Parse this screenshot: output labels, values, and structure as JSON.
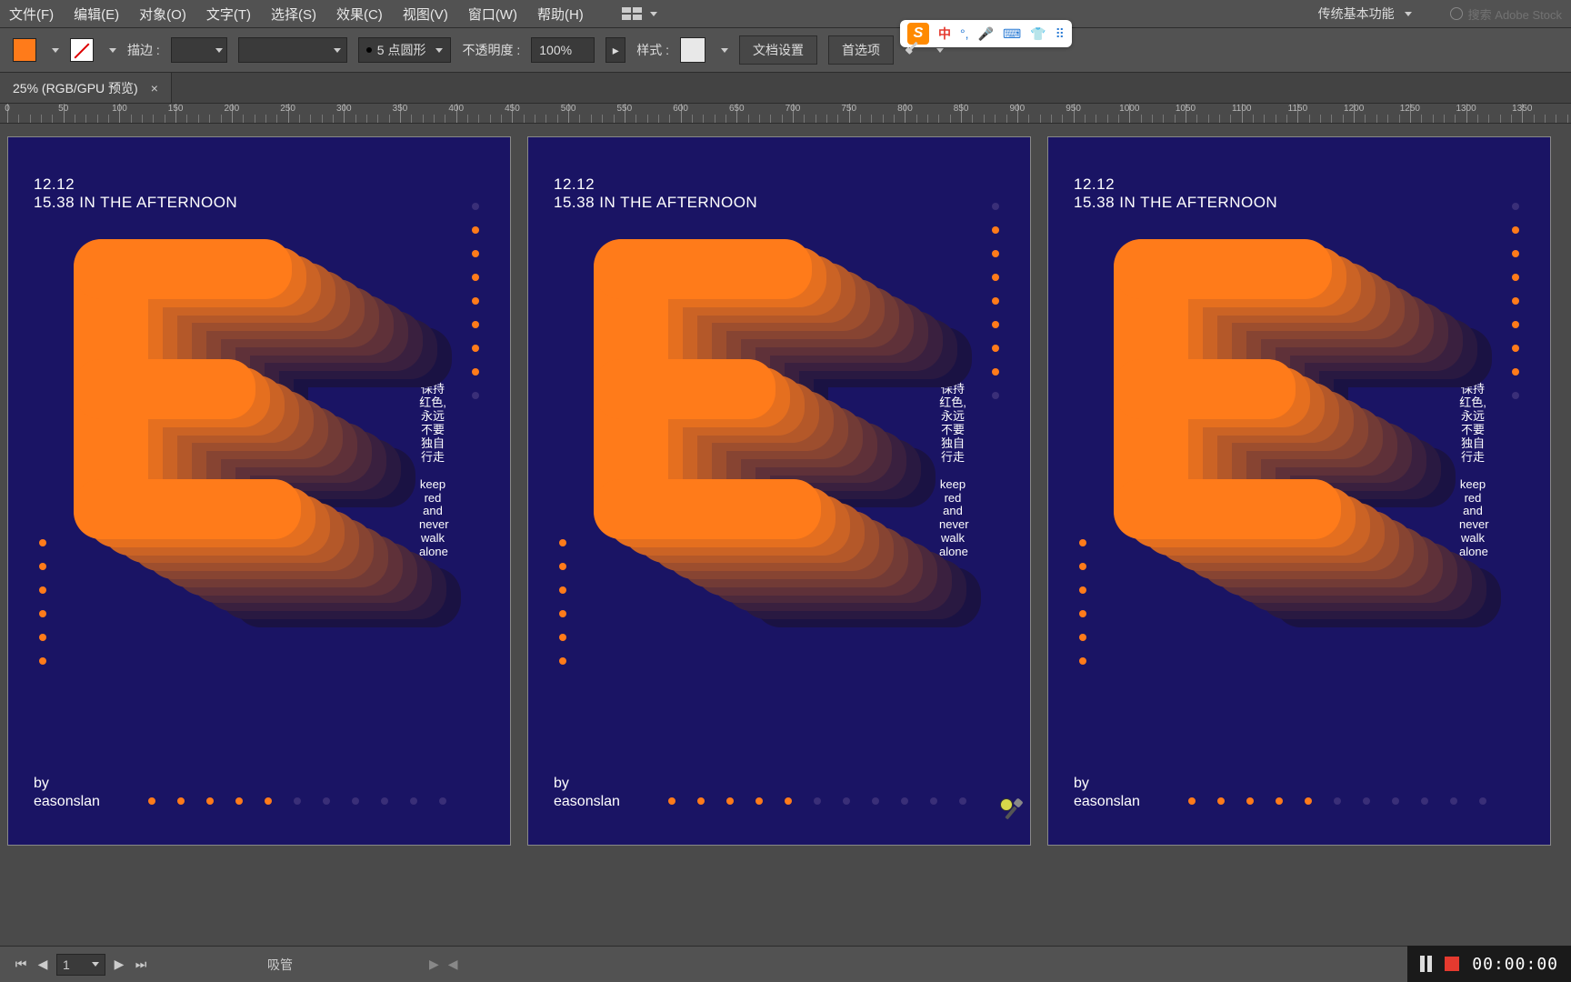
{
  "menu": {
    "file": "文件(F)",
    "edit": "编辑(E)",
    "object": "对象(O)",
    "type": "文字(T)",
    "select": "选择(S)",
    "effect": "效果(C)",
    "view": "视图(V)",
    "window": "窗口(W)",
    "help": "帮助(H)"
  },
  "workspace": {
    "label": "传统基本功能"
  },
  "search": {
    "placeholder": "搜索 Adobe Stock"
  },
  "control": {
    "stroke_label": "描边 :",
    "brush_value": "5 点圆形",
    "opacity_label": "不透明度 :",
    "opacity_value": "100%",
    "style_label": "样式 :",
    "doc_setup": "文档设置",
    "prefs": "首选项"
  },
  "tab": {
    "label": "25% (RGB/GPU 预览)",
    "close": "×"
  },
  "ruler": {
    "majors": [
      0,
      50,
      100,
      150,
      200,
      250,
      300,
      350,
      400,
      450,
      500,
      550,
      600,
      650,
      700,
      750,
      800,
      850,
      900,
      950,
      1000,
      1050,
      1100,
      1150,
      1200,
      1250,
      1300,
      1350
    ]
  },
  "poster": {
    "date": "12.12",
    "time": "15.38 IN THE AFTERNOON",
    "by": "by",
    "author": "easonslan",
    "vtext_cn": [
      "保持",
      "红色,",
      "永远",
      "不要",
      "独自",
      "行走"
    ],
    "vtext_en": [
      "keep",
      "red",
      "and",
      "never",
      "walk",
      "alone"
    ],
    "accent": "#ff7b1a",
    "bg": "#1a1464"
  },
  "ime": {
    "lang": "中"
  },
  "status": {
    "artboard_num": "1",
    "tool": "吸管"
  },
  "recorder": {
    "time": "00:00:00"
  }
}
